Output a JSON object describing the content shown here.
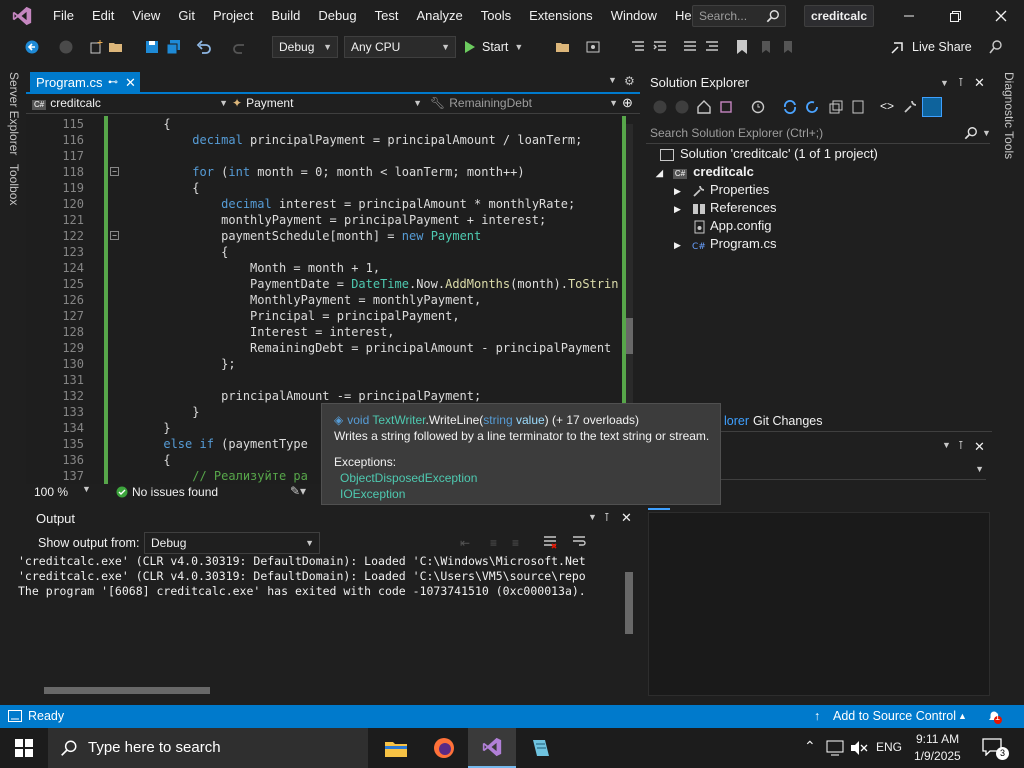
{
  "menu": {
    "items": [
      "File",
      "Edit",
      "View",
      "Git",
      "Project",
      "Build",
      "Debug",
      "Test",
      "Analyze",
      "Tools",
      "Extensions",
      "Window",
      "Help"
    ],
    "search_placeholder": "Search...",
    "project_title": "creditcalc"
  },
  "toolbar": {
    "config": "Debug",
    "platform": "Any CPU",
    "start_label": "Start",
    "live_share": "Live Share"
  },
  "side_tabs": {
    "server_explorer": "Server Explorer",
    "toolbox": "Toolbox",
    "diagnostic_tools": "Diagnostic Tools"
  },
  "editor": {
    "tab_name": "Program.cs",
    "nav_project": "creditcalc",
    "nav_type": "Payment",
    "nav_member": "RemainingDebt",
    "zoom": "100 %",
    "issues": "No issues found",
    "lines": [
      {
        "n": "115",
        "segs": [
          [
            "      {",
            "p"
          ]
        ]
      },
      {
        "n": "116",
        "segs": [
          [
            "          ",
            "p"
          ],
          [
            "decimal",
            "kw"
          ],
          [
            " principalPayment = principalAmount / loanTerm;",
            "p"
          ]
        ]
      },
      {
        "n": "117",
        "segs": [
          [
            "",
            "p"
          ]
        ]
      },
      {
        "n": "118",
        "segs": [
          [
            "          ",
            "p"
          ],
          [
            "for",
            "kw"
          ],
          [
            " (",
            "p"
          ],
          [
            "int",
            "kw"
          ],
          [
            " month = 0; month < loanTerm; month++)",
            "p"
          ]
        ]
      },
      {
        "n": "119",
        "segs": [
          [
            "          {",
            "p"
          ]
        ]
      },
      {
        "n": "120",
        "segs": [
          [
            "              ",
            "p"
          ],
          [
            "decimal",
            "kw"
          ],
          [
            " interest = principalAmount * monthlyRate;",
            "p"
          ]
        ]
      },
      {
        "n": "121",
        "segs": [
          [
            "              monthlyPayment = principalPayment + interest;",
            "p"
          ]
        ]
      },
      {
        "n": "122",
        "segs": [
          [
            "              paymentSchedule[month] = ",
            "p"
          ],
          [
            "new",
            "kw"
          ],
          [
            " ",
            "p"
          ],
          [
            "Payment",
            "ty"
          ]
        ]
      },
      {
        "n": "123",
        "segs": [
          [
            "              {",
            "p"
          ]
        ]
      },
      {
        "n": "124",
        "segs": [
          [
            "                  Month = month + 1,",
            "p"
          ]
        ]
      },
      {
        "n": "125",
        "segs": [
          [
            "                  PaymentDate = ",
            "p"
          ],
          [
            "DateTime",
            "ty"
          ],
          [
            ".Now.",
            "p"
          ],
          [
            "AddMonths",
            "me"
          ],
          [
            "(month).",
            "p"
          ],
          [
            "ToStrin",
            "me"
          ]
        ]
      },
      {
        "n": "126",
        "segs": [
          [
            "                  MonthlyPayment = monthlyPayment,",
            "p"
          ]
        ]
      },
      {
        "n": "127",
        "segs": [
          [
            "                  Principal = principalPayment,",
            "p"
          ]
        ]
      },
      {
        "n": "128",
        "segs": [
          [
            "                  Interest = interest,",
            "p"
          ]
        ]
      },
      {
        "n": "129",
        "segs": [
          [
            "                  RemainingDebt = principalAmount - principalPayment",
            "p"
          ]
        ]
      },
      {
        "n": "130",
        "segs": [
          [
            "              };",
            "p"
          ]
        ]
      },
      {
        "n": "131",
        "segs": [
          [
            "",
            "p"
          ]
        ]
      },
      {
        "n": "132",
        "segs": [
          [
            "              principalAmount -= principalPayment;",
            "p"
          ]
        ]
      },
      {
        "n": "133",
        "segs": [
          [
            "          }",
            "p"
          ]
        ]
      },
      {
        "n": "134",
        "segs": [
          [
            "      }",
            "p"
          ]
        ]
      },
      {
        "n": "135",
        "segs": [
          [
            "      ",
            "p"
          ],
          [
            "else if",
            "kw"
          ],
          [
            " (paymentType",
            "p"
          ]
        ]
      },
      {
        "n": "136",
        "segs": [
          [
            "      {",
            "p"
          ]
        ]
      },
      {
        "n": "137",
        "segs": [
          [
            "          ",
            "p"
          ],
          [
            "// Реализуйте ра",
            "cm"
          ]
        ]
      }
    ]
  },
  "tooltip": {
    "sig_void": "void",
    "sig_class": "TextWriter",
    "sig_method": ".WriteLine(",
    "sig_ptype": "string",
    "sig_pname": " value",
    "sig_tail": ") (+ 17 overloads)",
    "description": "Writes a string followed by a line terminator to the text string or stream.",
    "exceptions_header": "Exceptions:",
    "exceptions": [
      "ObjectDisposedException",
      "IOException"
    ]
  },
  "solution_explorer": {
    "title": "Solution Explorer",
    "search_placeholder": "Search Solution Explorer (Ctrl+;)",
    "solution_label": "Solution 'creditcalc' (1 of 1 project)",
    "project": "creditcalc",
    "items": [
      "Properties",
      "References",
      "App.config",
      "Program.cs"
    ],
    "bottom_tabs": [
      "Solution Explorer",
      "Git Changes"
    ],
    "bottom_tab_partial": "lorer"
  },
  "output": {
    "title": "Output",
    "show_from_label": "Show output from:",
    "source": "Debug",
    "lines": [
      "'creditcalc.exe' (CLR v4.0.30319: DefaultDomain): Loaded 'C:\\Windows\\Microsoft.Net",
      "'creditcalc.exe' (CLR v4.0.30319: DefaultDomain): Loaded 'C:\\Users\\VM5\\source\\repo",
      "The program '[6068] creditcalc.exe' has exited with code -1073741510 (0xc000013a)."
    ]
  },
  "status": {
    "ready": "Ready",
    "source_control": "Add to Source Control",
    "notifications": "1"
  },
  "taskbar": {
    "search_placeholder": "Type here to search",
    "language": "ENG",
    "time": "9:11 AM",
    "date": "1/9/2025",
    "notif_count": "3"
  },
  "colors": {
    "accent": "#007acc",
    "keyword": "#569cd6",
    "type": "#4ec9b0",
    "comment": "#57a64a"
  }
}
